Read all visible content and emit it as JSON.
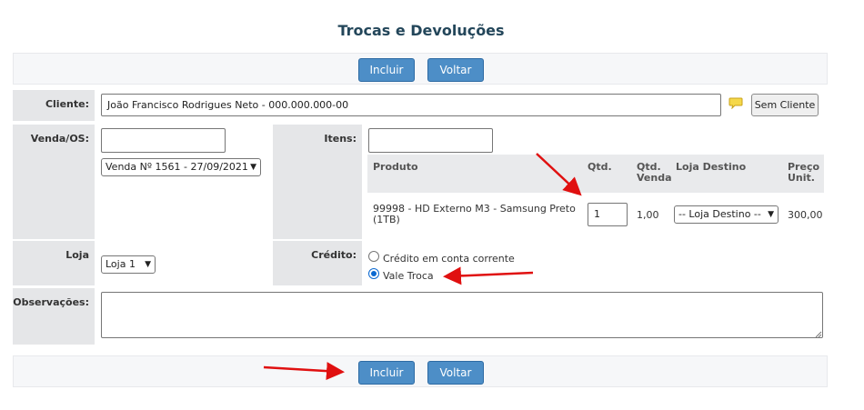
{
  "page": {
    "title": "Trocas e Devoluções"
  },
  "buttons": {
    "incluir": "Incluir",
    "voltar": "Voltar",
    "sem_cliente": "Sem Cliente"
  },
  "cliente": {
    "label": "Cliente:",
    "value": "João Francisco Rodrigues Neto - 000.000.000-00"
  },
  "venda": {
    "label": "Venda/OS:",
    "input_value": "",
    "select_value": "Venda Nº 1561 - 27/09/2021"
  },
  "itens": {
    "label": "Itens:",
    "search_value": "",
    "columns": [
      "Produto",
      "Qtd.",
      "Qtd. Venda",
      "Loja Destino",
      "Preço Unit."
    ],
    "row": {
      "produto": "99998 - HD Externo M3 - Samsung Preto (1TB)",
      "qtd": "1",
      "qtd_venda": "1,00",
      "loja_destino": "-- Loja Destino --",
      "preco": "300,00"
    }
  },
  "loja": {
    "label": "Loja",
    "value": "Loja 1"
  },
  "credito": {
    "label": "Crédito:",
    "options": [
      "Crédito em conta corrente",
      "Vale Troca"
    ],
    "selected": "Vale Troca"
  },
  "observacoes": {
    "label": "Observações:",
    "value": ""
  },
  "colors": {
    "button": "#4d8ec7",
    "title": "#23465a",
    "label_bg": "#e5e6e8",
    "annotation_arrow": "#e01010"
  },
  "icons": {
    "comment": "speech-bubble-icon"
  }
}
